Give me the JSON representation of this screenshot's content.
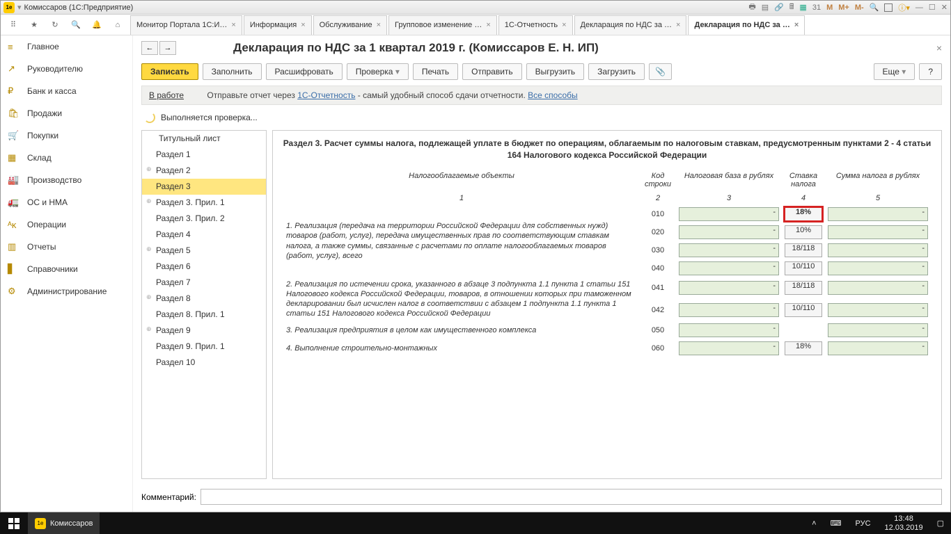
{
  "window": {
    "title": "Комиссаров  (1С:Предприятие)"
  },
  "top_tabs": [
    {
      "label": "Монитор Портала 1С:И…",
      "active": false
    },
    {
      "label": "Информация",
      "active": false
    },
    {
      "label": "Обслуживание",
      "active": false
    },
    {
      "label": "Групповое изменение …",
      "active": false
    },
    {
      "label": "1С-Отчетность",
      "active": false
    },
    {
      "label": "Декларация по НДС за …",
      "active": false
    },
    {
      "label": "Декларация по НДС за …",
      "active": true
    }
  ],
  "sidebar": [
    {
      "icon": "≡",
      "label": "Главное"
    },
    {
      "icon": "↗",
      "label": "Руководителю"
    },
    {
      "icon": "₽",
      "label": "Банк и касса"
    },
    {
      "icon": "🛍",
      "label": "Продажи"
    },
    {
      "icon": "🛒",
      "label": "Покупки"
    },
    {
      "icon": "▦",
      "label": "Склад"
    },
    {
      "icon": "🏭",
      "label": "Производство"
    },
    {
      "icon": "🚛",
      "label": "ОС и НМА"
    },
    {
      "icon": "ᴬᴋ",
      "label": "Операции"
    },
    {
      "icon": "▥",
      "label": "Отчеты"
    },
    {
      "icon": "▋",
      "label": "Справочники"
    },
    {
      "icon": "⚙",
      "label": "Администрирование"
    }
  ],
  "page": {
    "title": "Декларация по НДС за 1 квартал 2019 г. (Комиссаров Е. Н. ИП)",
    "buttons": {
      "save": "Записать",
      "fill": "Заполнить",
      "decode": "Расшифровать",
      "check": "Проверка",
      "print": "Печать",
      "send": "Отправить",
      "export": "Выгрузить",
      "import": "Загрузить",
      "more": "Еще",
      "help": "?"
    },
    "status": {
      "inwork": "В работе",
      "text1": "Отправьте отчет через ",
      "link1": "1С-Отчетность",
      "text2": " - самый удобный способ сдачи отчетности. ",
      "link2": "Все способы"
    },
    "checking": "Выполняется проверка...",
    "comment_label": "Комментарий:"
  },
  "tree": [
    {
      "label": "Титульный лист",
      "cls": "top"
    },
    {
      "label": "Раздел 1",
      "cls": ""
    },
    {
      "label": "Раздел 2",
      "cls": "expandable"
    },
    {
      "label": "Раздел 3",
      "cls": "selected"
    },
    {
      "label": "Раздел 3. Прил. 1",
      "cls": "expandable"
    },
    {
      "label": "Раздел 3. Прил. 2",
      "cls": ""
    },
    {
      "label": "Раздел 4",
      "cls": ""
    },
    {
      "label": "Раздел 5",
      "cls": "expandable"
    },
    {
      "label": "Раздел 6",
      "cls": ""
    },
    {
      "label": "Раздел 7",
      "cls": ""
    },
    {
      "label": "Раздел 8",
      "cls": "expandable"
    },
    {
      "label": "Раздел 8. Прил. 1",
      "cls": ""
    },
    {
      "label": "Раздел 9",
      "cls": "expandable"
    },
    {
      "label": "Раздел 9. Прил. 1",
      "cls": ""
    },
    {
      "label": "Раздел 10",
      "cls": ""
    }
  ],
  "form": {
    "section_title": "Раздел 3. Расчет суммы налога, подлежащей уплате в бюджет по операциям, облагаемым по налоговым ставкам, предусмотренным пунктами 2 - 4 статьи 164 Налогового кодекса Российской Федерации",
    "headers": {
      "c1": "Налогооблагаемые объекты",
      "c2": "Код строки",
      "c3": "Налоговая база в рублях",
      "c4": "Ставка налога",
      "c5": "Сумма налога в рублях"
    },
    "colnums": {
      "n1": "1",
      "n2": "2",
      "n3": "3",
      "n4": "4",
      "n5": "5"
    },
    "desc1": "1. Реализация (передача на территории Российской Федерации для собственных нужд) товаров (работ, услуг), передача имущественных прав по соответствующим ставкам налога, а также суммы, связанные с расчетами по оплате налогооблагаемых товаров (работ, услуг), всего",
    "desc2": "2. Реализация по истечении срока, указанного в абзаце 3 подпункта 1.1 пункта 1 статьи 151 Налогового кодекса Российской Федерации, товаров, в отношении которых при таможенном декларировании был исчислен налог в соответствии с абзацем 1 подпункта 1.1 пункта 1 статьи 151 Налогового кодекса Российской Федерации",
    "desc3": "3. Реализация предприятия в целом как имущественного комплекса",
    "desc4": "4. Выполнение строительно-монтажных",
    "rows": [
      {
        "code": "010",
        "base": "-",
        "rate": "18%",
        "tax": "-",
        "hl": true
      },
      {
        "code": "020",
        "base": "-",
        "rate": "10%",
        "tax": "-"
      },
      {
        "code": "030",
        "base": "-",
        "rate": "18/118",
        "tax": "-"
      },
      {
        "code": "040",
        "base": "-",
        "rate": "10/110",
        "tax": "-"
      },
      {
        "code": "041",
        "base": "-",
        "rate": "18/118",
        "tax": "-"
      },
      {
        "code": "042",
        "base": "-",
        "rate": "10/110",
        "tax": "-"
      },
      {
        "code": "050",
        "base": "-",
        "rate": "",
        "tax": "-"
      },
      {
        "code": "060",
        "base": "-",
        "rate": "18%",
        "tax": "-"
      }
    ]
  },
  "taskbar": {
    "app": "Комиссаров",
    "lang": "РУС",
    "time": "13:48",
    "date": "12.03.2019"
  }
}
